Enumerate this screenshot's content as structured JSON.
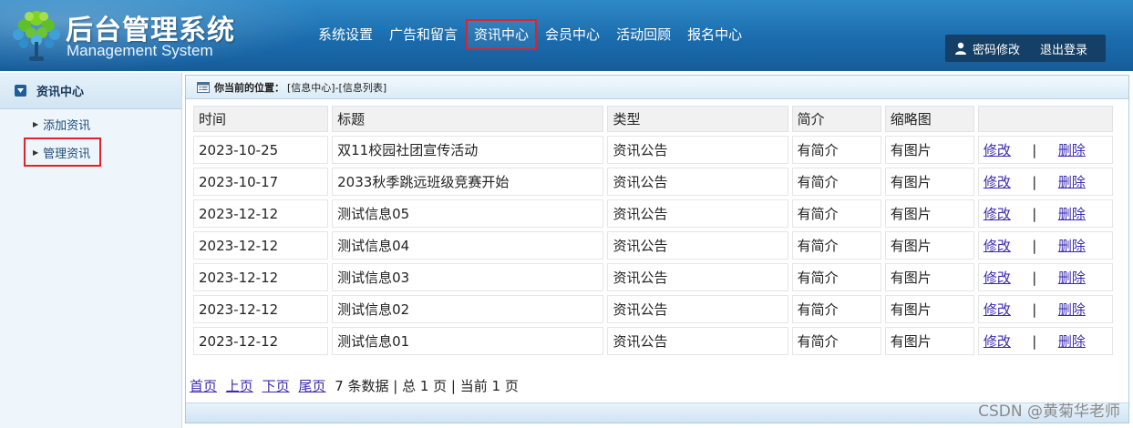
{
  "header": {
    "title": "后台管理系统",
    "subtitle": "Management System",
    "logo_icon": "tree-logo-icon",
    "nav": [
      {
        "label": "系统设置",
        "active": false
      },
      {
        "label": "广告和留言",
        "active": false
      },
      {
        "label": "资讯中心",
        "active": true
      },
      {
        "label": "会员中心",
        "active": false
      },
      {
        "label": "活动回顾",
        "active": false
      },
      {
        "label": "报名中心",
        "active": false
      }
    ],
    "user_icon": "user-icon",
    "change_password": "密码修改",
    "logout": "退出登录"
  },
  "sidebar": {
    "head_icon": "collapse-icon",
    "title": "资讯中心",
    "items": [
      {
        "label": "添加资讯",
        "selected": false
      },
      {
        "label": "管理资讯",
        "selected": true
      }
    ]
  },
  "breadcrumb": {
    "icon": "list-icon",
    "label": "你当前的位置：",
    "path": "[信息中心]-[信息列表]"
  },
  "table": {
    "columns": [
      "时间",
      "标题",
      "类型",
      "简介",
      "缩略图",
      ""
    ],
    "edit_label": "修改",
    "separator": "|",
    "delete_label": "删除",
    "rows": [
      {
        "time": "2023-10-25",
        "title": "双11校园社团宣传活动",
        "type": "资讯公告",
        "intro": "有简介",
        "thumb": "有图片"
      },
      {
        "time": "2023-10-17",
        "title": "2033秋季跳远班级竞赛开始",
        "type": "资讯公告",
        "intro": "有简介",
        "thumb": "有图片"
      },
      {
        "time": "2023-12-12",
        "title": "测试信息05",
        "type": "资讯公告",
        "intro": "有简介",
        "thumb": "有图片"
      },
      {
        "time": "2023-12-12",
        "title": "测试信息04",
        "type": "资讯公告",
        "intro": "有简介",
        "thumb": "有图片"
      },
      {
        "time": "2023-12-12",
        "title": "测试信息03",
        "type": "资讯公告",
        "intro": "有简介",
        "thumb": "有图片"
      },
      {
        "time": "2023-12-12",
        "title": "测试信息02",
        "type": "资讯公告",
        "intro": "有简介",
        "thumb": "有图片"
      },
      {
        "time": "2023-12-12",
        "title": "测试信息01",
        "type": "资讯公告",
        "intro": "有简介",
        "thumb": "有图片"
      }
    ]
  },
  "pager": {
    "first": "首页",
    "prev": "上页",
    "next": "下页",
    "last": "尾页",
    "summary": "7 条数据 | 总 1 页 | 当前 1 页"
  },
  "watermark": "CSDN @黄菊华老师",
  "colors": {
    "header_blue": "#1b6cad",
    "highlight_red": "#e0222a",
    "link_purple": "#3a2bb0",
    "userbar_navy": "#143f66"
  }
}
